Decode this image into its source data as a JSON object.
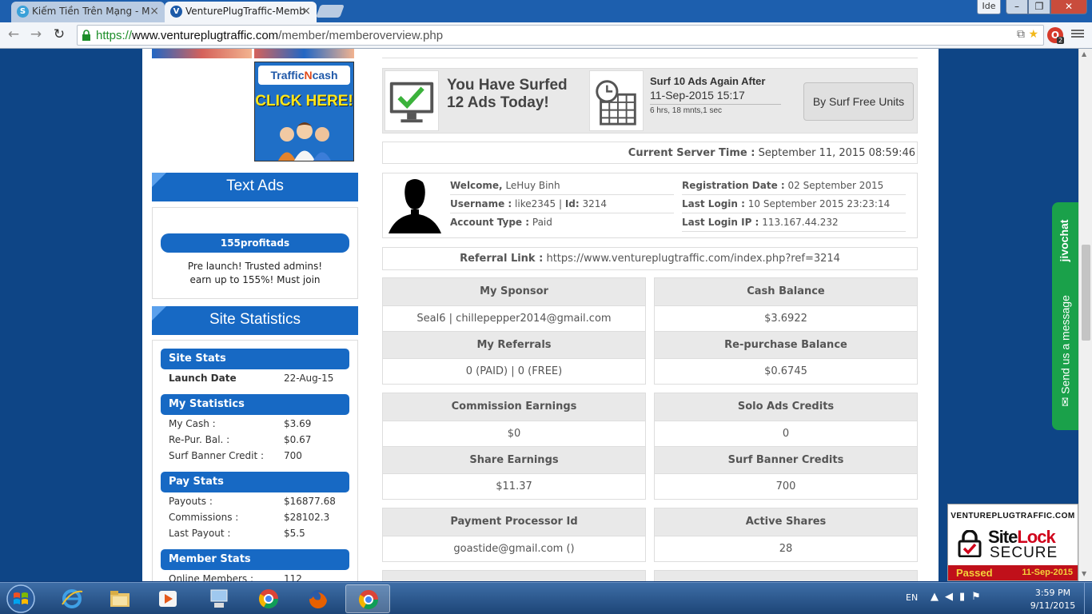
{
  "browser": {
    "tabs": [
      {
        "title": "Kiếm Tiền Trên Mạng - M",
        "active": false
      },
      {
        "title": "VenturePlugTraffic-Memb",
        "active": true
      }
    ],
    "user_button": "Ide",
    "url": {
      "scheme": "https://",
      "host": "www.ventureplugtraffic.com",
      "path": "/member/memberoverview.php"
    },
    "extension_badge": "2"
  },
  "sidebar": {
    "banner": {
      "logo_left": "Traffic",
      "logo_n": "N",
      "logo_right": "cash",
      "cta": "CLICK HERE!"
    },
    "text_ads": {
      "heading": "Text Ads",
      "ad_title": "155profitads",
      "ad_line1": "Pre launch! Trusted admins!",
      "ad_line2": "earn up to 155%! Must join"
    },
    "site_statistics": {
      "heading": "Site Statistics",
      "sections": [
        {
          "title": "Site Stats",
          "rows": [
            {
              "label": "Launch Date",
              "value": "22-Aug-15"
            }
          ]
        },
        {
          "title": "My Statistics",
          "rows": [
            {
              "label": "My Cash :",
              "value": "$3.69"
            },
            {
              "label": "Re-Pur. Bal. :",
              "value": "$0.67"
            },
            {
              "label": "Surf Banner Credit :",
              "value": "700"
            }
          ]
        },
        {
          "title": "Pay Stats",
          "rows": [
            {
              "label": "Payouts :",
              "value": "$16877.68"
            },
            {
              "label": "Commissions :",
              "value": "$28102.3"
            },
            {
              "label": "Last Payout :",
              "value": "$5.5"
            }
          ]
        },
        {
          "title": "Member Stats",
          "rows": [
            {
              "label": "Online Members :",
              "value": "112"
            }
          ]
        }
      ]
    }
  },
  "surf": {
    "count_line1": "You Have Surfed",
    "count_line2": "12 Ads Today!",
    "again_title": "Surf 10 Ads Again After",
    "again_date": "11-Sep-2015 15:17",
    "time_left": "6 hrs, 18 mnts,1 sec",
    "button": "By Surf Free Units"
  },
  "server_time": {
    "label": "Current Server Time :",
    "value": "September 11, 2015 08:59:46"
  },
  "profile": {
    "welcome_label": "Welcome,",
    "name": "LeHuy Binh",
    "username_label": "Username :",
    "username": "like2345",
    "id_label": "Id:",
    "id": "3214",
    "account_type_label": "Account Type :",
    "account_type": "Paid",
    "reg_label": "Registration Date :",
    "reg_date": "02 September 2015",
    "last_login_label": "Last Login :",
    "last_login": "10 September 2015 23:23:14",
    "last_ip_label": "Last Login IP :",
    "last_ip": "113.167.44.232"
  },
  "referral": {
    "label": "Referral Link :",
    "link": "https://www.ventureplugtraffic.com/index.php?ref=3214"
  },
  "stats": {
    "my_sponsor": {
      "label": "My Sponsor",
      "value": "Seal6 | chillepepper2014@gmail.com"
    },
    "cash_balance": {
      "label": "Cash Balance",
      "value": "$3.6922"
    },
    "my_referrals": {
      "label": "My Referrals",
      "value": "0 (PAID) | 0 (FREE)"
    },
    "repurchase_balance": {
      "label": "Re-purchase Balance",
      "value": "$0.6745"
    },
    "commission_earnings": {
      "label": "Commission Earnings",
      "value": "$0"
    },
    "solo_ads_credits": {
      "label": "Solo Ads Credits",
      "value": "0"
    },
    "share_earnings": {
      "label": "Share Earnings",
      "value": "$11.37"
    },
    "surf_banner_credits": {
      "label": "Surf Banner Credits",
      "value": "700"
    },
    "payment_processor": {
      "label": "Payment Processor Id",
      "value": "goastide@gmail.com ()"
    },
    "active_shares": {
      "label": "Active Shares",
      "value": "28"
    }
  },
  "jivochat": {
    "brand": "jivochat",
    "cta": "Send us a message"
  },
  "sitelock": {
    "domain": "VENTUREPLUGTRAFFIC.COM",
    "name_site": "Site",
    "name_lock": "Lock",
    "secure": "SECURE",
    "status": "Passed",
    "date": "11-Sep-2015"
  },
  "taskbar": {
    "lang": "EN",
    "time": "3:59 PM",
    "date": "9/11/2015"
  }
}
